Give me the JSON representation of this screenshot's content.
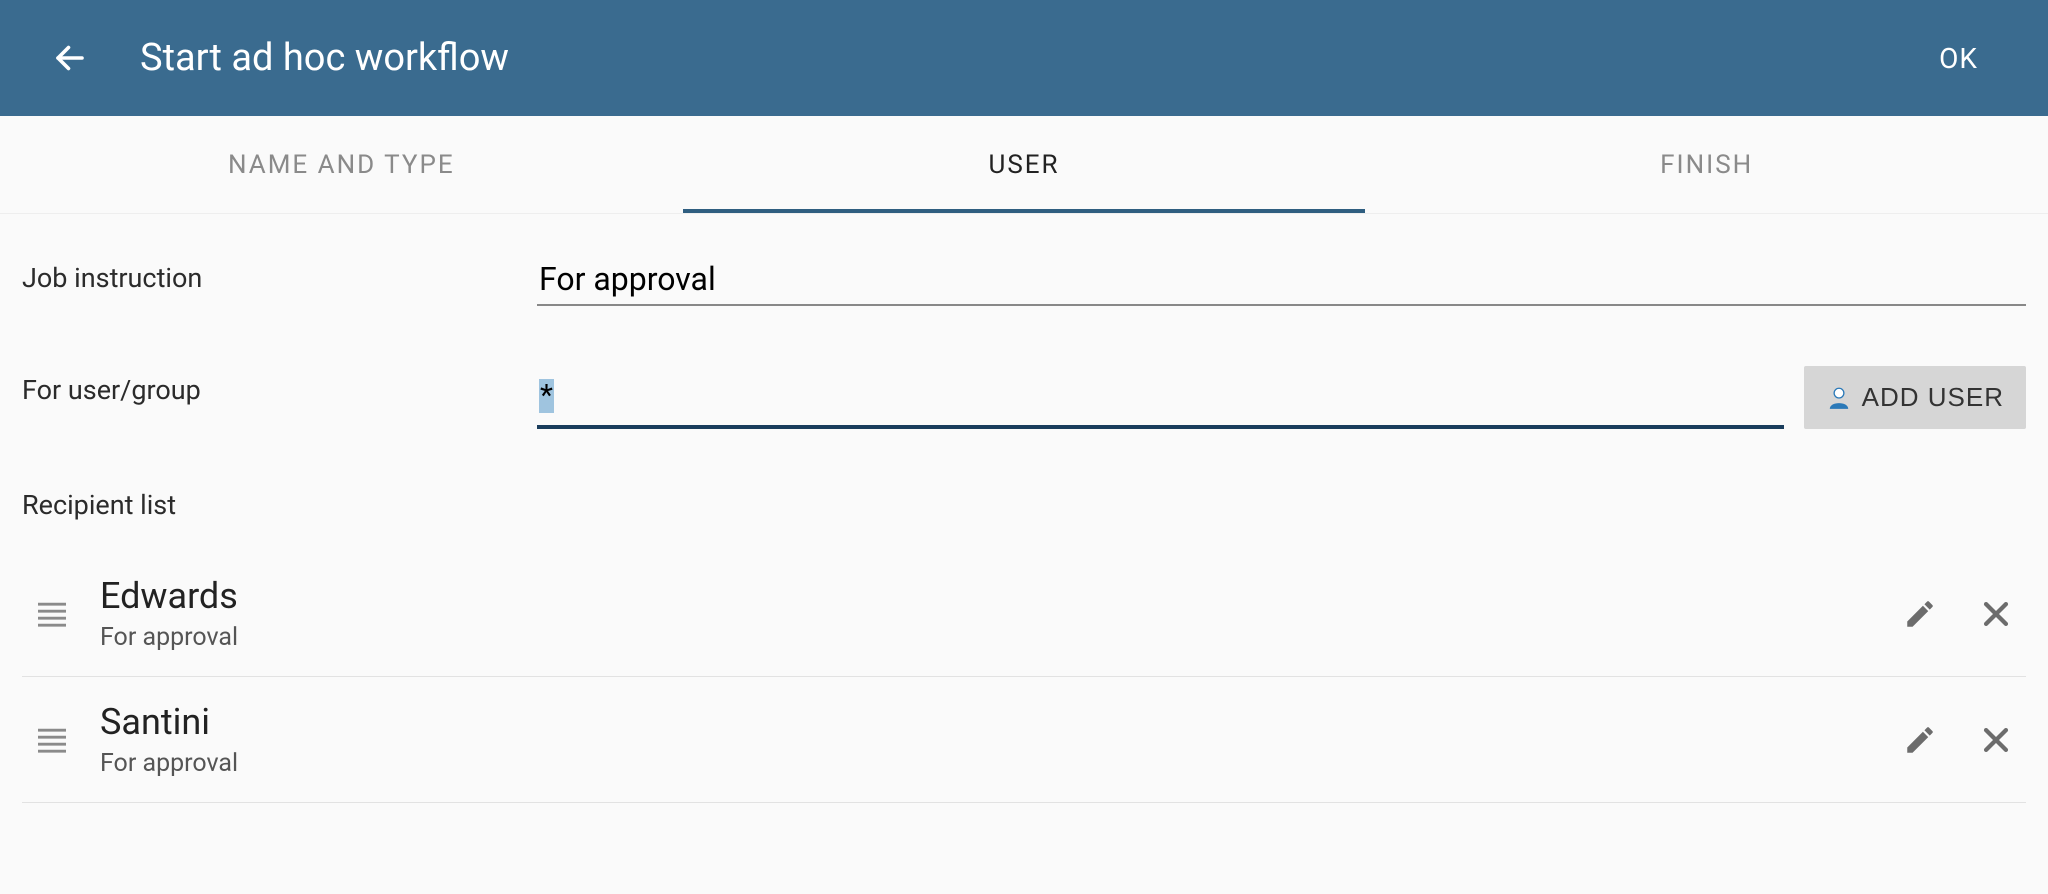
{
  "header": {
    "title": "Start ad hoc workflow",
    "ok_label": "OK"
  },
  "tabs": [
    {
      "label": "NAME AND TYPE",
      "active": false
    },
    {
      "label": "USER",
      "active": true
    },
    {
      "label": "FINISH",
      "active": false
    }
  ],
  "form": {
    "job_instruction_label": "Job instruction",
    "job_instruction_value": "For approval",
    "user_group_label": "For user/group",
    "user_group_value": "*",
    "add_user_label": "ADD USER"
  },
  "recipient_list_label": "Recipient list",
  "recipients": [
    {
      "name": "Edwards",
      "note": "For approval"
    },
    {
      "name": "Santini",
      "note": "For approval"
    }
  ]
}
